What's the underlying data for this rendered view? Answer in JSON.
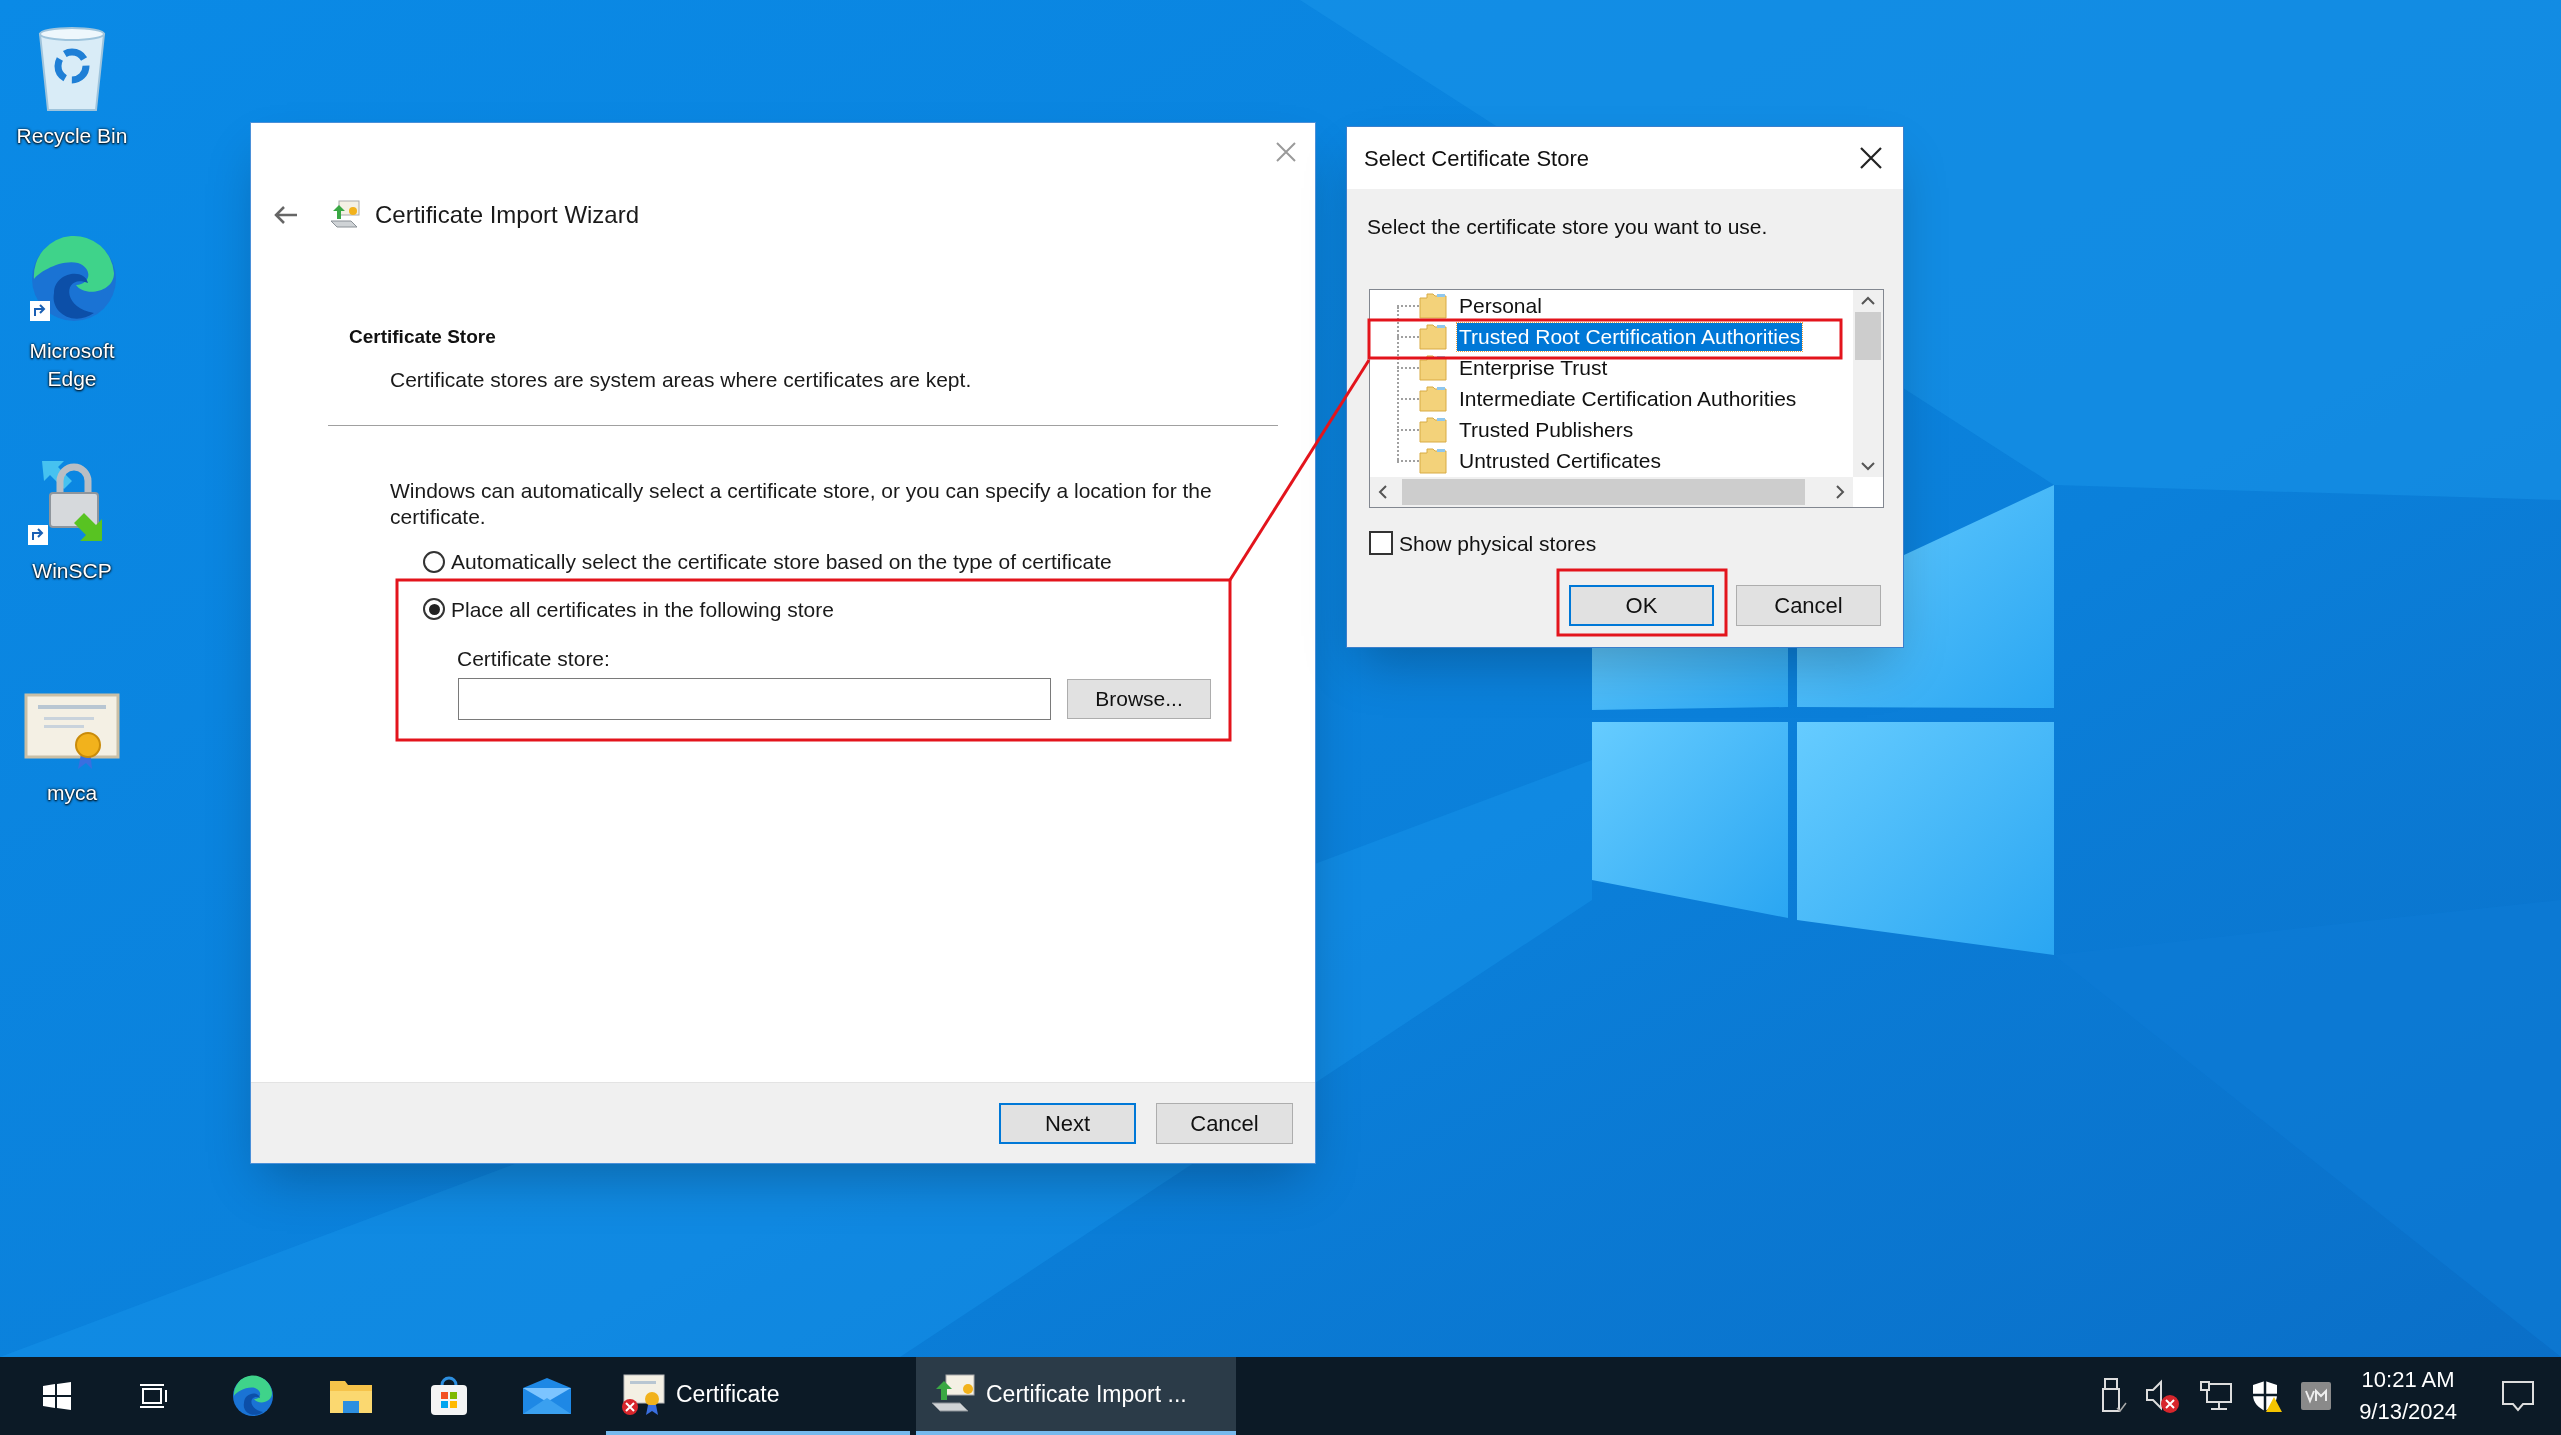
{
  "desktop_icons": [
    {
      "label": "Recycle Bin",
      "kind": "trash"
    },
    {
      "label": "Microsoft Edge",
      "kind": "browser"
    },
    {
      "label": "WinSCP",
      "kind": "transfer"
    },
    {
      "label": "myca",
      "kind": "certificate"
    }
  ],
  "wizard": {
    "title": "Certificate Import Wizard",
    "heading": "Certificate Store",
    "subheading": "Certificate stores are system areas where certificates are kept.",
    "intro": "Windows can automatically select a certificate store, or you can specify a location for the certificate.",
    "options": [
      {
        "label": "Automatically select the certificate store based on the type of certificate",
        "selected": false
      },
      {
        "label": "Place all certificates in the following store",
        "selected": true
      }
    ],
    "store_label": "Certificate store:",
    "browse_button": "Browse...",
    "buttons": [
      {
        "label": "Next",
        "default": true
      },
      {
        "label": "Cancel",
        "default": false
      }
    ]
  },
  "store_dialog": {
    "title": "Select Certificate Store",
    "prompt": "Select the certificate store you want to use.",
    "stores": [
      {
        "label": "Personal",
        "selected": false
      },
      {
        "label": "Trusted Root Certification Authorities",
        "selected": true
      },
      {
        "label": "Enterprise Trust",
        "selected": false
      },
      {
        "label": "Intermediate Certification Authorities",
        "selected": false
      },
      {
        "label": "Trusted Publishers",
        "selected": false
      },
      {
        "label": "Untrusted Certificates",
        "selected": false
      }
    ],
    "show_physical": {
      "label": "Show physical stores",
      "checked": false
    },
    "buttons": [
      {
        "label": "OK",
        "default": true
      },
      {
        "label": "Cancel",
        "default": false
      }
    ]
  },
  "taskbar": {
    "apps": [
      {
        "label": "Certificate",
        "active": false,
        "kind": "certificate"
      },
      {
        "label": "Certificate Import ...",
        "active": true,
        "kind": "wizard"
      }
    ],
    "time": "10:21 AM",
    "date": "9/13/2024"
  }
}
